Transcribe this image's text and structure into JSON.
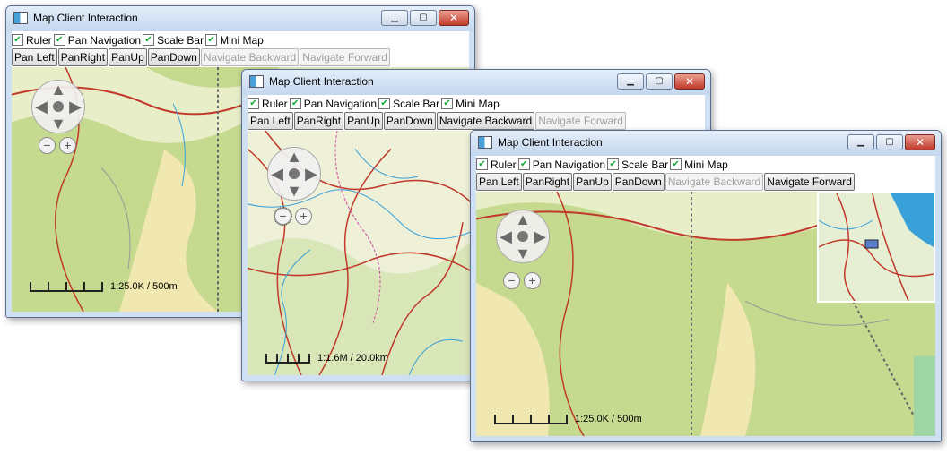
{
  "windows": [
    {
      "title": "Map Client Interaction",
      "checkboxes": [
        "Ruler",
        "Pan Navigation",
        "Scale Bar",
        "Mini Map"
      ],
      "buttons": [
        {
          "label": "Pan Left",
          "enabled": true
        },
        {
          "label": "PanRight",
          "enabled": true
        },
        {
          "label": "PanUp",
          "enabled": true
        },
        {
          "label": "PanDown",
          "enabled": true
        },
        {
          "label": "Navigate Backward",
          "enabled": false
        },
        {
          "label": "Navigate Forward",
          "enabled": false
        }
      ],
      "scale": "1:25.0K / 500m"
    },
    {
      "title": "Map Client Interaction",
      "checkboxes": [
        "Ruler",
        "Pan Navigation",
        "Scale Bar",
        "Mini Map"
      ],
      "buttons": [
        {
          "label": "Pan Left",
          "enabled": true
        },
        {
          "label": "PanRight",
          "enabled": true
        },
        {
          "label": "PanUp",
          "enabled": true
        },
        {
          "label": "PanDown",
          "enabled": true
        },
        {
          "label": "Navigate Backward",
          "enabled": true
        },
        {
          "label": "Navigate Forward",
          "enabled": false
        }
      ],
      "scale": "1:1.6M / 20.0km"
    },
    {
      "title": "Map Client Interaction",
      "checkboxes": [
        "Ruler",
        "Pan Navigation",
        "Scale Bar",
        "Mini Map"
      ],
      "buttons": [
        {
          "label": "Pan Left",
          "enabled": true
        },
        {
          "label": "PanRight",
          "enabled": true
        },
        {
          "label": "PanUp",
          "enabled": true
        },
        {
          "label": "PanDown",
          "enabled": true
        },
        {
          "label": "Navigate Backward",
          "enabled": false
        },
        {
          "label": "Navigate Forward",
          "enabled": true
        }
      ],
      "scale": "1:25.0K / 500m"
    }
  ],
  "icons": {
    "minimize": "minimize-icon",
    "maximize": "maximize-icon",
    "close": "close-icon",
    "pan": "pan-navigation-icon",
    "zoom_in": "zoom-in-icon",
    "zoom_out": "zoom-out-icon"
  },
  "colors": {
    "map_land": "#e8eec8",
    "map_forest": "#c5d98f",
    "map_road": "#c0392b",
    "map_water": "#3aa0d8",
    "window_frame": "#cfe0f3"
  }
}
